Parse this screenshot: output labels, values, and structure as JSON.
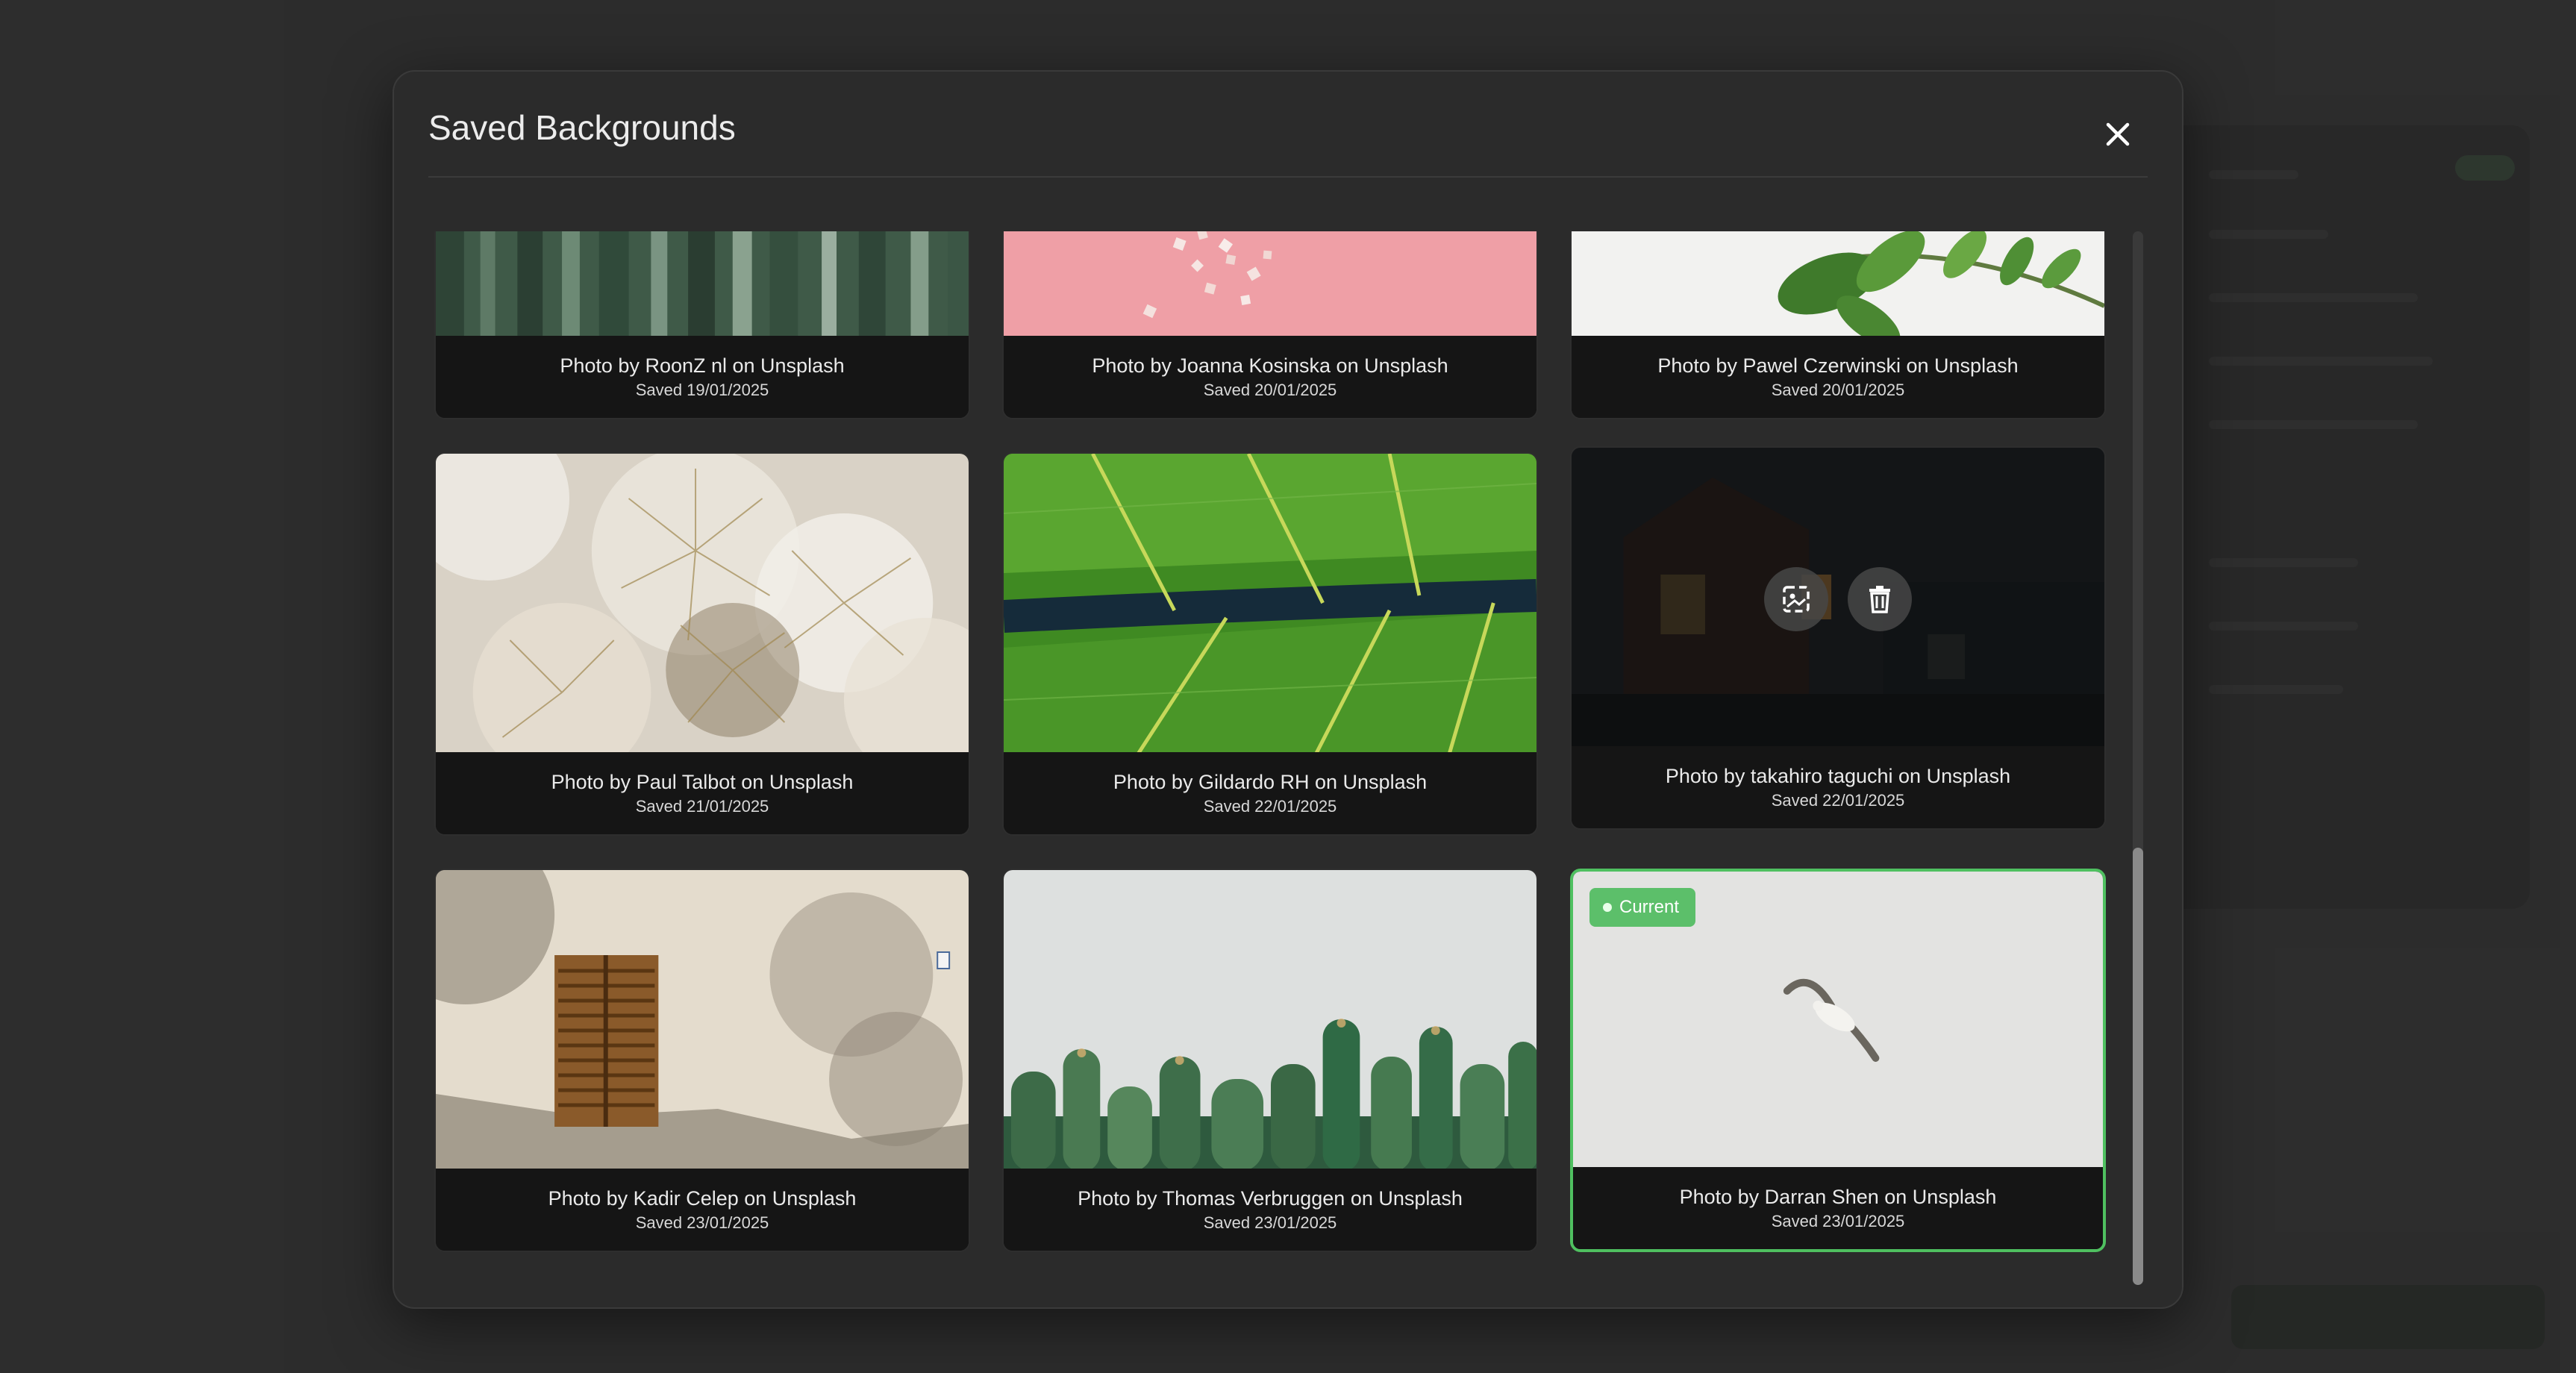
{
  "modal": {
    "title": "Saved Backgrounds",
    "close_icon": "close-icon"
  },
  "backgrounds": [
    {
      "title": "Photo by RoonZ nl on Unsplash",
      "date": "Saved 19/01/2025"
    },
    {
      "title": "Photo by Joanna Kosinska on Unsplash",
      "date": "Saved 20/01/2025"
    },
    {
      "title": "Photo by Pawel Czerwinski on Unsplash",
      "date": "Saved 20/01/2025"
    },
    {
      "title": "Photo by Paul Talbot on Unsplash",
      "date": "Saved 21/01/2025"
    },
    {
      "title": "Photo by Gildardo RH on Unsplash",
      "date": "Saved 22/01/2025"
    },
    {
      "title": "Photo by takahiro taguchi on Unsplash",
      "date": "Saved 22/01/2025"
    },
    {
      "title": "Photo by Kadir Celep on Unsplash",
      "date": "Saved 23/01/2025"
    },
    {
      "title": "Photo by Thomas Verbruggen on Unsplash",
      "date": "Saved 23/01/2025"
    },
    {
      "title": "Photo by Darran Shen on Unsplash",
      "date": "Saved 23/01/2025"
    }
  ],
  "current_badge": "Current",
  "hover_actions": {
    "apply_icon": "set-background-icon",
    "delete_icon": "trash-icon"
  },
  "colors": {
    "accent": "#5cbf6a",
    "modal_bg": "#2b2b2b",
    "card_caption_bg": "#151515"
  }
}
